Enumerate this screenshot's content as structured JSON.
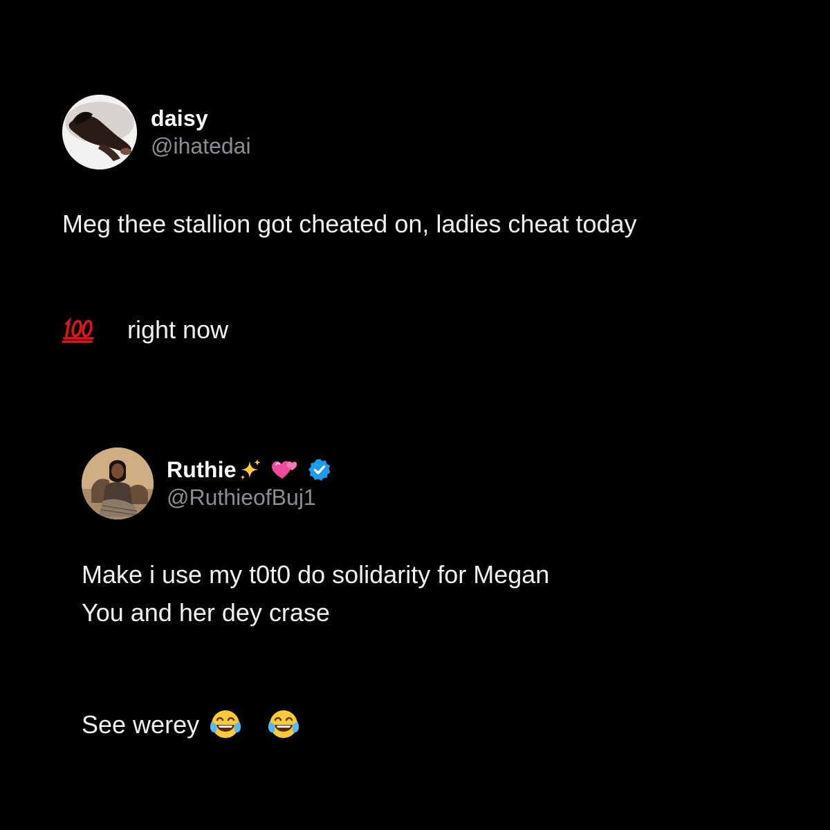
{
  "tweets": [
    {
      "display_name": "daisy",
      "handle": "@ihatedai",
      "text_lines": [
        "Meg thee stallion got cheated on, ladies cheat today",
        "right now"
      ],
      "inline_emoji": "hundred-points-icon"
    },
    {
      "display_name": "Ruthie",
      "name_emojis": [
        "sparkles-icon",
        "two-hearts-icon"
      ],
      "verified": true,
      "handle": "@RuthieofBuj1",
      "text_lines": [
        "Make i use my t0t0 do solidarity for Megan",
        "You and her dey crase",
        "See werey"
      ],
      "trailing_emojis": [
        "tears-of-joy-icon",
        "tears-of-joy-icon"
      ]
    }
  ],
  "colors": {
    "background": "#000000",
    "text": "#f2f2f2",
    "handle": "#8b8f94",
    "verified": "#1d9bf0"
  }
}
